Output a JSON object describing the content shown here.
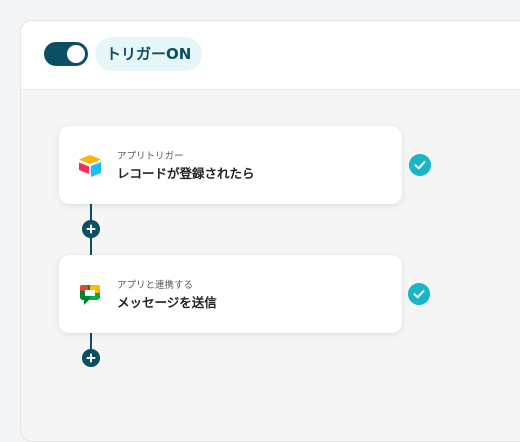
{
  "header": {
    "toggle_on": true,
    "trigger_label": "トリガーON"
  },
  "steps": [
    {
      "kind_label": "アプリトリガー",
      "title": "レコードが登録されたら",
      "app_icon": "airtable-icon",
      "status": "completed"
    },
    {
      "kind_label": "アプリと連携する",
      "title": "メッセージを送信",
      "app_icon": "google-chat-icon",
      "status": "completed"
    }
  ],
  "colors": {
    "primary": "#0b4f63",
    "check": "#19b6c6",
    "badge_bg": "#e6f6f7"
  }
}
